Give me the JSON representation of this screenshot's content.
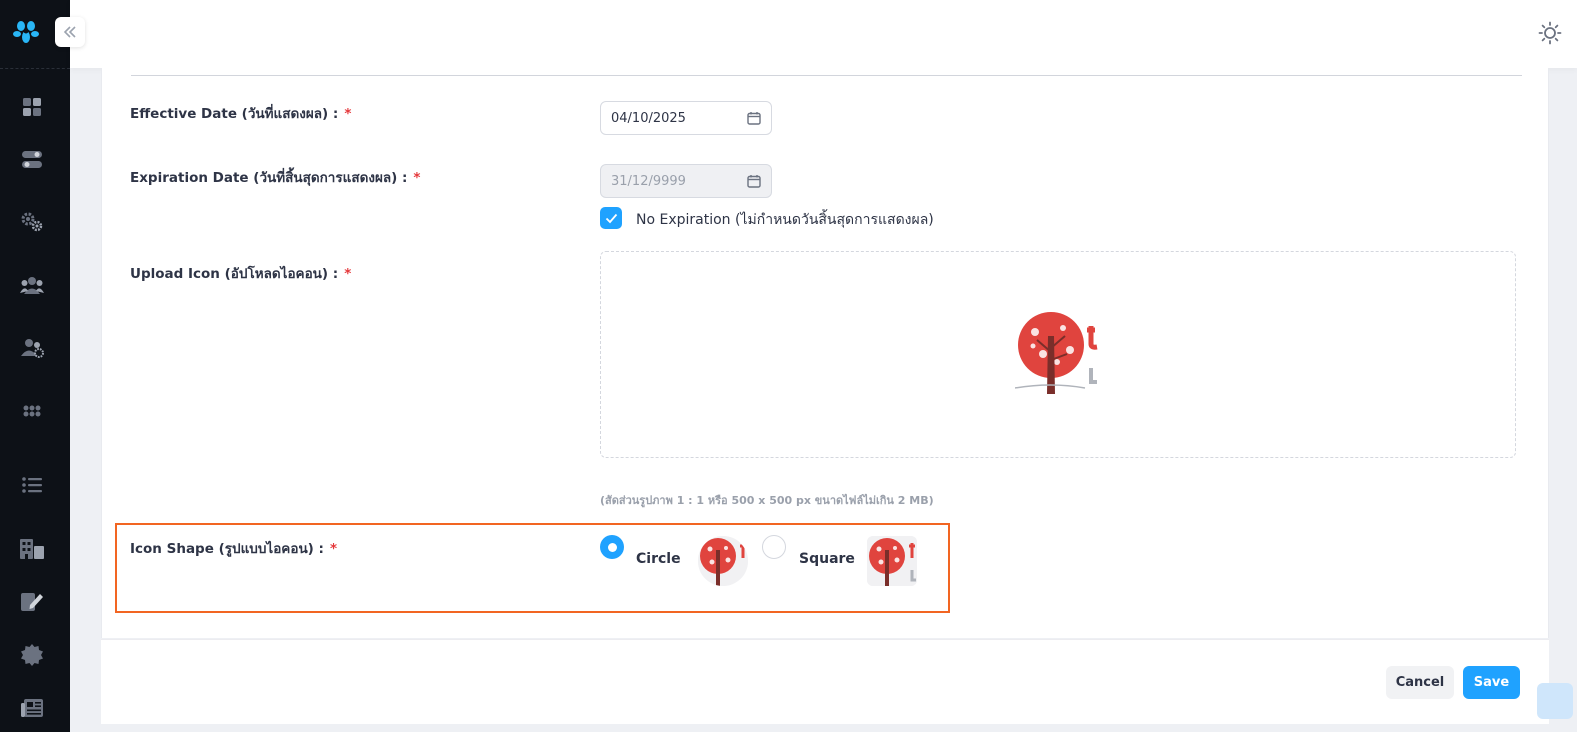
{
  "form": {
    "effective_date": {
      "label": "Effective Date (วันที่แสดงผล) :",
      "required_mark": "*",
      "value": "04/10/2025"
    },
    "expiration_date": {
      "label": "Expiration Date (วันที่สิ้นสุดการแสดงผล) :",
      "required_mark": "*",
      "value": "31/12/9999",
      "disabled": true
    },
    "no_expiration": {
      "label": "No Expiration (ไม่กำหนดวันสิ้นสุดการแสดงผล)",
      "checked": true
    },
    "upload_icon": {
      "label": "Upload Icon (อัปโหลดไอคอน) :",
      "required_mark": "*",
      "hint": "(สัดส่วนรูปภาพ 1 : 1 หรือ 500 x 500 px ขนาดไฟล์ไม่เกิน 2 MB)"
    },
    "icon_shape": {
      "label": "Icon Shape (รูปแบบไอคอน) :",
      "required_mark": "*",
      "options": [
        {
          "label": "Circle",
          "selected": true
        },
        {
          "label": "Square",
          "selected": false
        }
      ]
    }
  },
  "footer": {
    "cancel_label": "Cancel",
    "save_label": "Save"
  },
  "colors": {
    "accent": "#1fa2ff",
    "highlight": "#f26522",
    "required": "#e5383b",
    "sidebar": "#0d1117",
    "logo_red": "#e0443e"
  },
  "icons": {
    "sidebar": [
      "dashboard-icon",
      "toggle-icon",
      "settings-icon",
      "users-icon",
      "user-group-icon",
      "apps-grid-icon",
      "list-icon",
      "building-icon",
      "edit-document-icon",
      "gear-badge-icon",
      "newspaper-icon"
    ],
    "topbar": [
      "sun-icon",
      "avatar"
    ]
  }
}
